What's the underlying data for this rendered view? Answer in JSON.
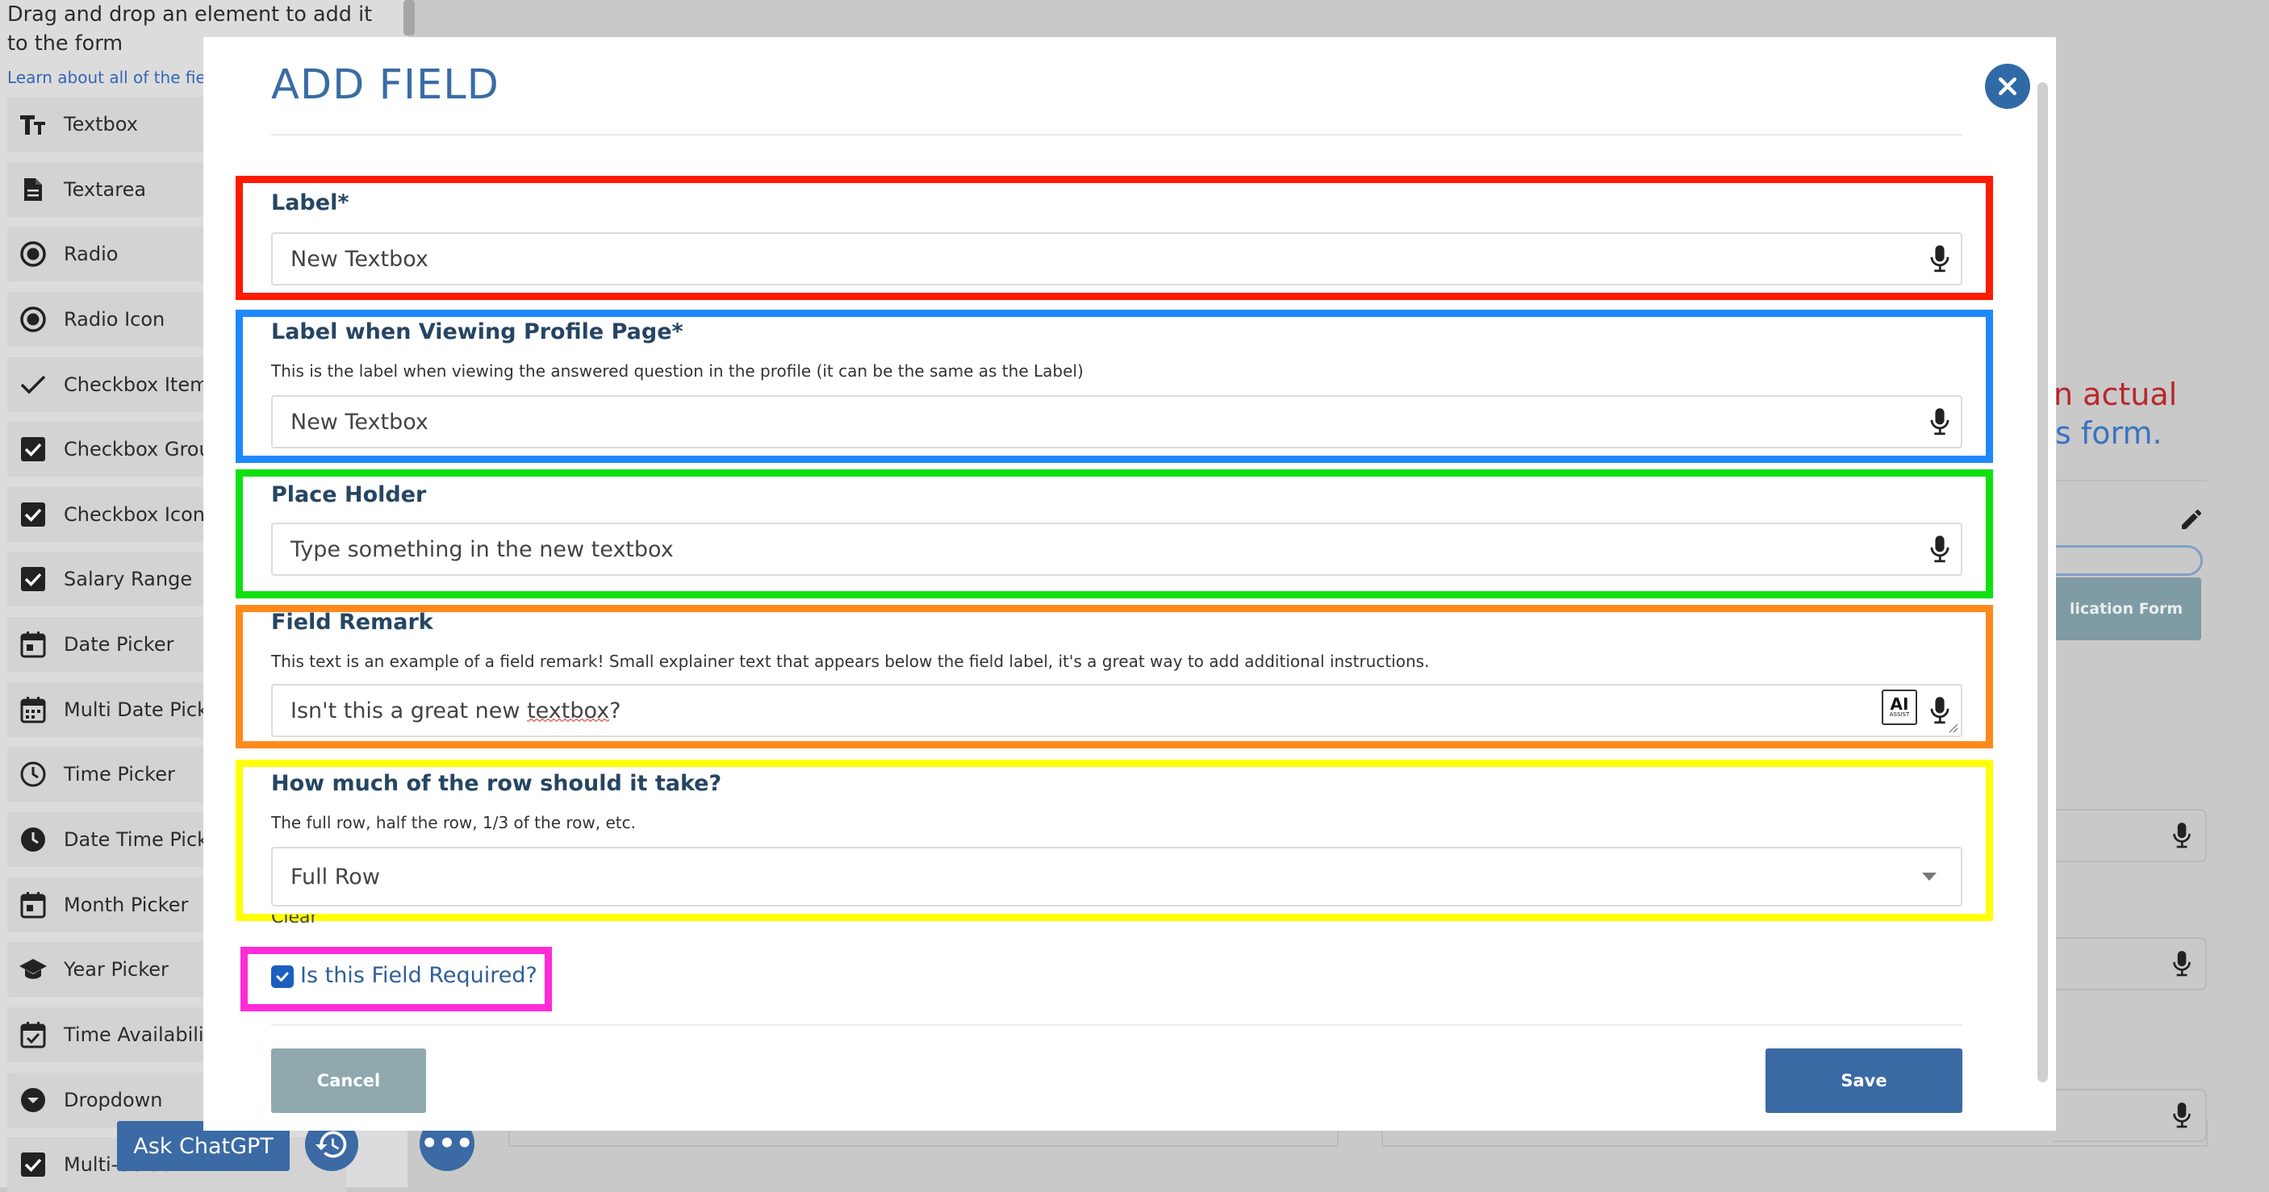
{
  "sidebar": {
    "instructions": "Drag and drop an element to add it to the form",
    "learn_link": "Learn about all of the fie",
    "items": [
      {
        "label": "Textbox",
        "icon": "text-type-icon"
      },
      {
        "label": "Textarea",
        "icon": "document-icon"
      },
      {
        "label": "Radio",
        "icon": "radio-icon"
      },
      {
        "label": "Radio Icon",
        "icon": "radio-icon"
      },
      {
        "label": "Checkbox Item",
        "icon": "checkmark-icon"
      },
      {
        "label": "Checkbox Grou",
        "icon": "checkbox-icon"
      },
      {
        "label": "Checkbox Icon",
        "icon": "checkbox-icon"
      },
      {
        "label": "Salary Range",
        "icon": "checkbox-icon"
      },
      {
        "label": "Date Picker",
        "icon": "calendar-icon"
      },
      {
        "label": "Multi Date Picke",
        "icon": "calendar-multi-icon"
      },
      {
        "label": "Time Picker",
        "icon": "clock-icon"
      },
      {
        "label": "Date Time Picke",
        "icon": "clock-filled-icon"
      },
      {
        "label": "Month Picker",
        "icon": "calendar-icon"
      },
      {
        "label": "Year Picker",
        "icon": "graduation-cap-icon"
      },
      {
        "label": "Time Availability",
        "icon": "calendar-check-icon"
      },
      {
        "label": "Dropdown",
        "icon": "dropdown-icon"
      },
      {
        "label": "Multi-Select",
        "icon": "checkbox-icon"
      }
    ]
  },
  "background": {
    "line1": "n actual",
    "line2": "s form.",
    "app_button": "lication Form"
  },
  "bottom_bar": {
    "ask_label": "Ask ChatGPT",
    "more_label": "•••"
  },
  "modal": {
    "title": "ADD FIELD",
    "fields": {
      "label": {
        "label": "Label*",
        "value": "New Textbox"
      },
      "profile_label": {
        "label": "Label when Viewing Profile Page*",
        "help": "This is the label when viewing the answered question in the profile (it can be the same as the Label)",
        "value": "New Textbox"
      },
      "placeholder": {
        "label": "Place Holder",
        "value": "Type something in the new textbox"
      },
      "remark": {
        "label": "Field Remark",
        "help": "This text is an example of a field remark! Small explainer text that appears below the field label, it's a great way to add additional instructions.",
        "value_prefix": "Isn't this a great new ",
        "value_spell": "textbox",
        "value_suffix": "?",
        "ai_badge": "AI",
        "ai_badge_sub": "ASSIST"
      },
      "row_width": {
        "label": "How much of the row should it take?",
        "help": "The full row, half the row, 1/3 of the row, etc.",
        "selected": "Full Row",
        "clear": "Clear"
      }
    },
    "required": {
      "label": "Is this Field Required?",
      "checked": true
    },
    "cancel_label": "Cancel",
    "save_label": "Save"
  },
  "highlight_colors": {
    "label": "#ff1a00",
    "profile_label": "#1e88ff",
    "placeholder": "#10e010",
    "remark": "#ff8a1c",
    "row_width": "#ffff00",
    "required": "#ff2ad8"
  }
}
